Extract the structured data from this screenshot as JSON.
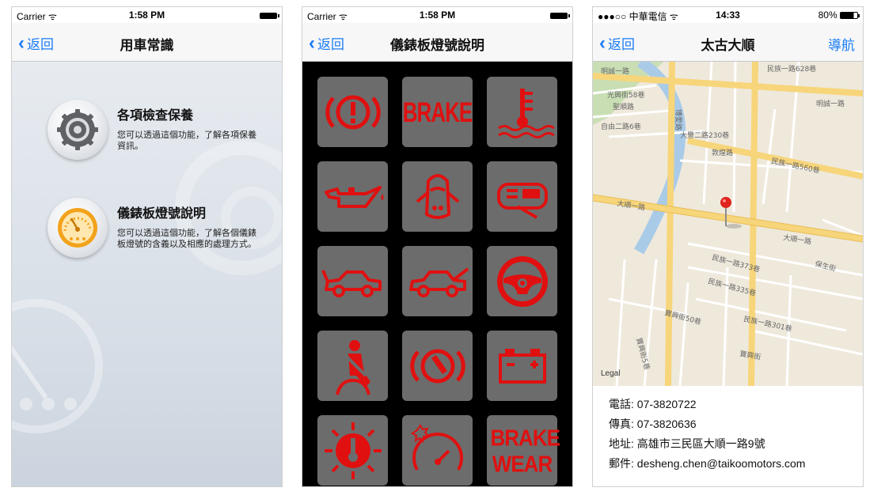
{
  "screen1": {
    "status": {
      "carrier": "Carrier",
      "time": "1:58 PM"
    },
    "nav": {
      "back": "返回",
      "title": "用車常識"
    },
    "items": [
      {
        "title": "各項檢查保養",
        "desc": "您可以透過這個功能，了解各項保養資訊。",
        "icon": "gear-icon"
      },
      {
        "title": "儀錶板燈號說明",
        "desc": "您可以透過這個功能，了解各個儀錶板燈號的含義以及相應的處理方式。",
        "icon": "speedometer-icon"
      }
    ]
  },
  "screen2": {
    "status": {
      "carrier": "Carrier",
      "time": "1:58 PM"
    },
    "nav": {
      "back": "返回",
      "title": "儀錶板燈號說明"
    },
    "tiles": [
      {
        "icon": "brake-warning-icon"
      },
      {
        "icon": "brake-text-icon",
        "text": "BRAKE"
      },
      {
        "icon": "coolant-temperature-icon"
      },
      {
        "icon": "oil-pressure-icon"
      },
      {
        "icon": "door-open-icon"
      },
      {
        "icon": "headlight-icon"
      },
      {
        "icon": "trunk-open-icon"
      },
      {
        "icon": "hood-open-icon"
      },
      {
        "icon": "steering-wheel-icon"
      },
      {
        "icon": "seatbelt-icon"
      },
      {
        "icon": "brake-pad-icon"
      },
      {
        "icon": "battery-icon"
      },
      {
        "icon": "engine-temperature-icon"
      },
      {
        "icon": "speedometer-warning-icon"
      },
      {
        "icon": "brake-wear-text-icon",
        "text": "BRAKE WEAR"
      }
    ]
  },
  "screen3": {
    "status": {
      "carrier": "●●●○○ 中華電信",
      "time": "14:33",
      "battery": "80%"
    },
    "nav": {
      "back": "返回",
      "title": "太古大順",
      "right": "導航"
    },
    "map": {
      "legal": "Legal",
      "labels": [
        "明誠一路",
        "光興街58巷",
        "聖順路",
        "自由二路6巷",
        "民族一路628巷",
        "明誠一路",
        "博愛路",
        "大豐二路230巷",
        "敦煌路",
        "民族一路560巷",
        "大順一路",
        "大順一路",
        "民族一路373巷",
        "保生街",
        "民族一路335巷",
        "寶興街50巷",
        "民族一路301巷",
        "寶興街5巷",
        "寶興街"
      ]
    },
    "info": {
      "phone": "電話: 07-3820722",
      "fax": "傳真: 07-3820636",
      "address": "地址: 高雄市三民區大順一路9號",
      "email": "郵件: desheng.chen@taikoomotors.com"
    }
  }
}
